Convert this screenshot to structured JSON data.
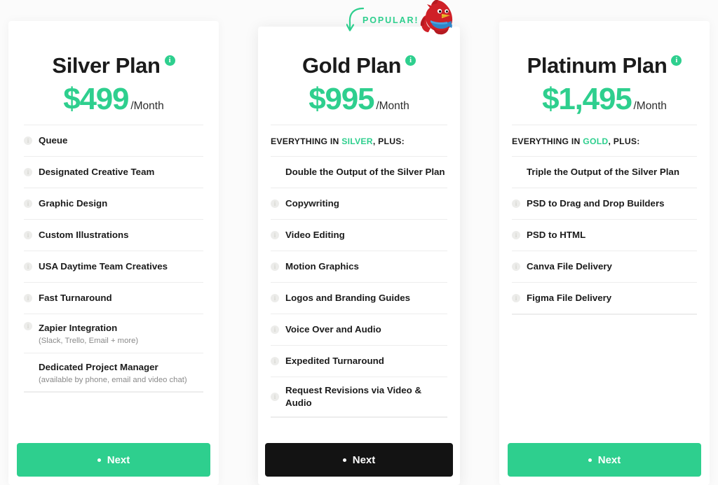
{
  "theme": {
    "accent_green": "#2ecf8e",
    "dark_button": "#131313",
    "page_background": "#fbfbfb",
    "card_background": "#ffffff"
  },
  "popular_badge": {
    "label": "POPULAR!",
    "arrow_icon": "curved-down-arrow-icon",
    "mascot_icon": "cardinal-bird-mascot-icon"
  },
  "plans": [
    {
      "id": "silver",
      "title": "Silver Plan",
      "info_icon": "info-icon",
      "price": "$499",
      "period": "/Month",
      "everything_in": null,
      "features": [
        {
          "label": "Queue",
          "sub": null,
          "icon": true,
          "bold": false
        },
        {
          "label": "Designated Creative Team",
          "sub": null,
          "icon": true,
          "bold": false
        },
        {
          "label": "Graphic Design",
          "sub": null,
          "icon": true,
          "bold": false
        },
        {
          "label": "Custom Illustrations",
          "sub": null,
          "icon": true,
          "bold": false
        },
        {
          "label": "USA Daytime Team Creatives",
          "sub": null,
          "icon": true,
          "bold": false
        },
        {
          "label": "Fast Turnaround",
          "sub": null,
          "icon": true,
          "bold": false
        },
        {
          "label": "Zapier Integration",
          "sub": "(Slack, Trello, Email + more)",
          "icon": true,
          "bold": false
        },
        {
          "label": "Dedicated Project Manager",
          "sub": "(available by phone, email and video chat)",
          "icon": false,
          "bold": false
        }
      ],
      "cta_label": "Next",
      "cta_style": "green"
    },
    {
      "id": "gold",
      "title": "Gold Plan",
      "info_icon": "info-icon",
      "price": "$995",
      "period": "/Month",
      "everything_in": {
        "prefix": "EVERYTHING IN ",
        "tier": "SILVER",
        "suffix": ", PLUS:"
      },
      "features": [
        {
          "label": "Double the Output of the Silver Plan",
          "sub": null,
          "icon": false,
          "bold": true
        },
        {
          "label": "Copywriting",
          "sub": null,
          "icon": true,
          "bold": false
        },
        {
          "label": "Video Editing",
          "sub": null,
          "icon": true,
          "bold": false
        },
        {
          "label": "Motion Graphics",
          "sub": null,
          "icon": true,
          "bold": false
        },
        {
          "label": "Logos and Branding Guides",
          "sub": null,
          "icon": true,
          "bold": false
        },
        {
          "label": "Voice Over and Audio",
          "sub": null,
          "icon": true,
          "bold": false
        },
        {
          "label": "Expedited Turnaround",
          "sub": null,
          "icon": true,
          "bold": false
        },
        {
          "label": "Request Revisions via Video & Audio",
          "sub": null,
          "icon": true,
          "bold": false
        }
      ],
      "cta_label": "Next",
      "cta_style": "dark"
    },
    {
      "id": "platinum",
      "title": "Platinum Plan",
      "info_icon": "info-icon",
      "price": "$1,495",
      "period": "/Month",
      "everything_in": {
        "prefix": "EVERYTHING IN ",
        "tier": "GOLD",
        "suffix": ", PLUS:"
      },
      "features": [
        {
          "label": "Triple the Output of the Silver Plan",
          "sub": null,
          "icon": false,
          "bold": true
        },
        {
          "label": "PSD to Drag and Drop Builders",
          "sub": null,
          "icon": true,
          "bold": false
        },
        {
          "label": "PSD to HTML",
          "sub": null,
          "icon": true,
          "bold": false
        },
        {
          "label": "Canva File Delivery",
          "sub": null,
          "icon": true,
          "bold": false
        },
        {
          "label": "Figma File Delivery",
          "sub": null,
          "icon": true,
          "bold": false
        }
      ],
      "cta_label": "Next",
      "cta_style": "green"
    }
  ]
}
